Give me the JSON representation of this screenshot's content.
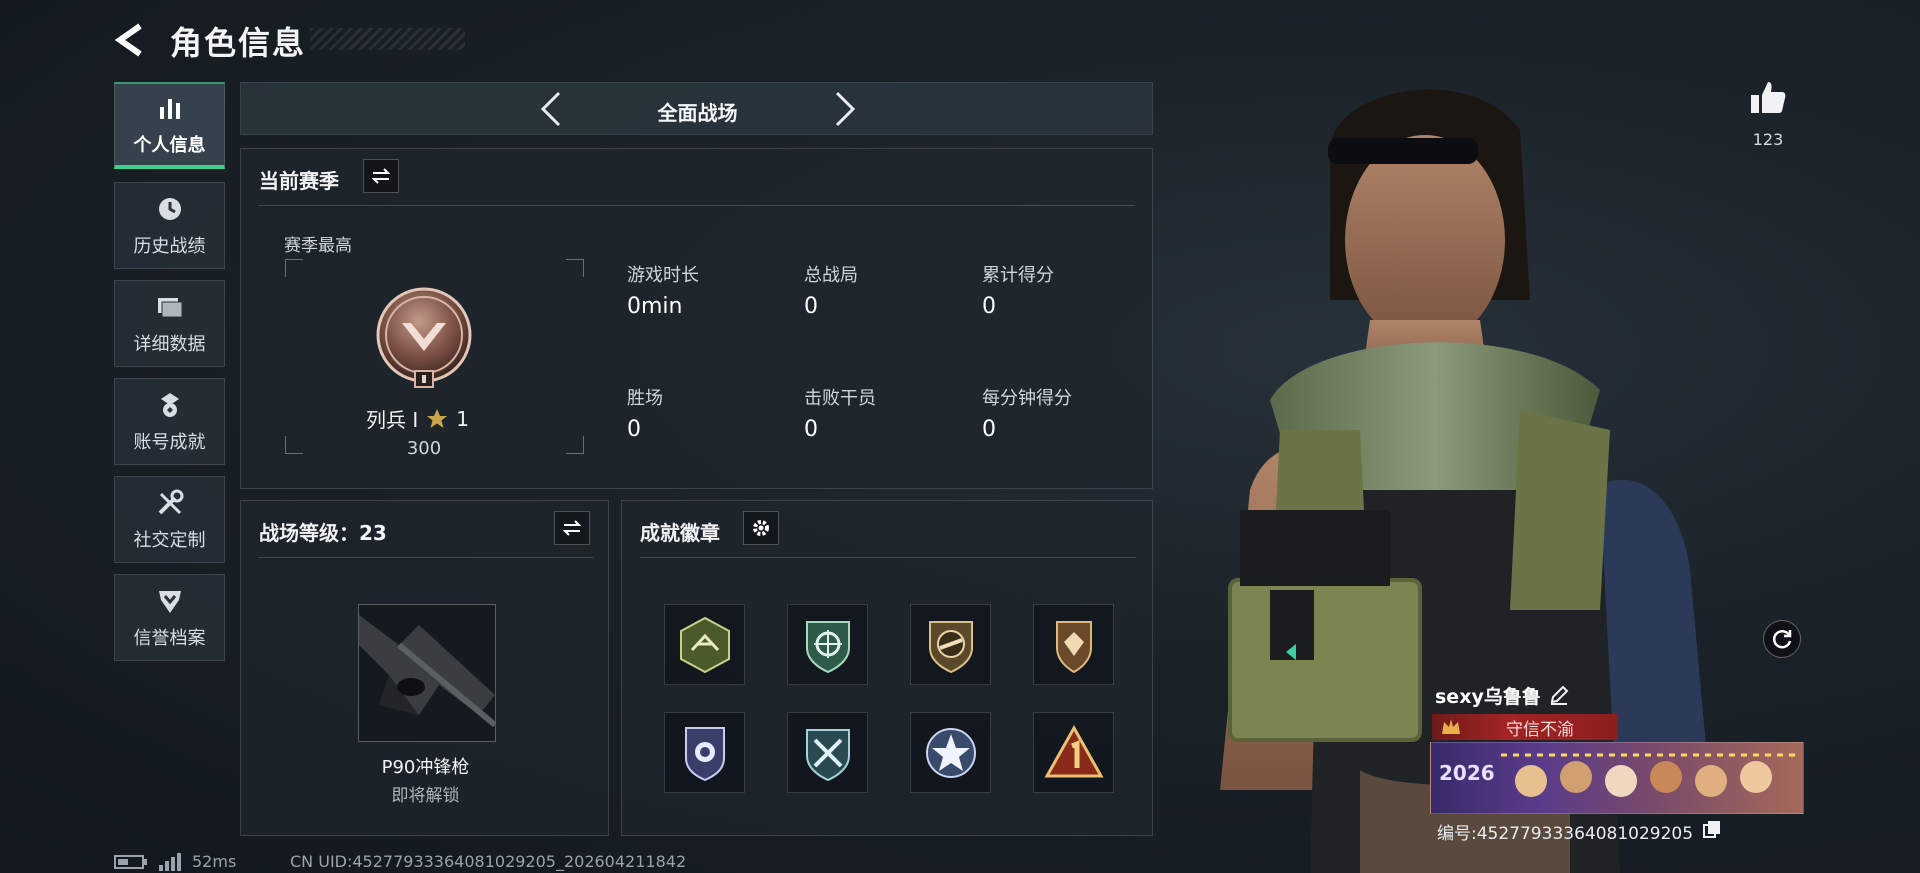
{
  "header": {
    "title": "角色信息"
  },
  "sidebar": {
    "items": [
      {
        "label": "个人信息",
        "icon": "bar-chart-icon",
        "active": true
      },
      {
        "label": "历史战绩",
        "icon": "clock-icon",
        "active": false
      },
      {
        "label": "详细数据",
        "icon": "folder-icon",
        "active": false
      },
      {
        "label": "账号成就",
        "icon": "medal-icon",
        "active": false
      },
      {
        "label": "社交定制",
        "icon": "tools-icon",
        "active": false
      },
      {
        "label": "信誉档案",
        "icon": "shield-chevron-icon",
        "active": false
      }
    ]
  },
  "mode": {
    "label": "全面战场"
  },
  "season": {
    "title": "当前赛季",
    "best_label": "赛季最高",
    "rank_name": "列兵 I",
    "rank_stars": "1",
    "rank_points": "300",
    "stats": [
      {
        "label": "游戏时长",
        "value": "0min"
      },
      {
        "label": "总战局",
        "value": "0"
      },
      {
        "label": "累计得分",
        "value": "0"
      },
      {
        "label": "胜场",
        "value": "0"
      },
      {
        "label": "击败干员",
        "value": "0"
      },
      {
        "label": "每分钟得分",
        "value": "0"
      }
    ]
  },
  "battlefield_level": {
    "title": "战场等级：23",
    "weapon_name": "P90冲锋枪",
    "weapon_status": "即将解锁"
  },
  "achievements": {
    "title": "成就徽章",
    "badges": [
      "hexagon-wasp-badge",
      "shield-crosshair-badge",
      "circle-rifle-badge",
      "shield-gem-badge",
      "police-badge",
      "shield-swords-badge",
      "star-emblem-badge",
      "triangle-number-one-badge"
    ]
  },
  "profile": {
    "likes": "123",
    "player_name": "sexy乌鲁鲁",
    "honor_title": "守信不渝",
    "player_id": "编号:4527793336408102​9205",
    "card_year": "2026"
  },
  "status": {
    "ping": "52ms",
    "uid": "CN UID:4527793336408102​9205_202604211842"
  },
  "colors": {
    "accent": "#3ecf8e",
    "honor_red": "#a32424",
    "panel_bg": "#1e262d"
  }
}
